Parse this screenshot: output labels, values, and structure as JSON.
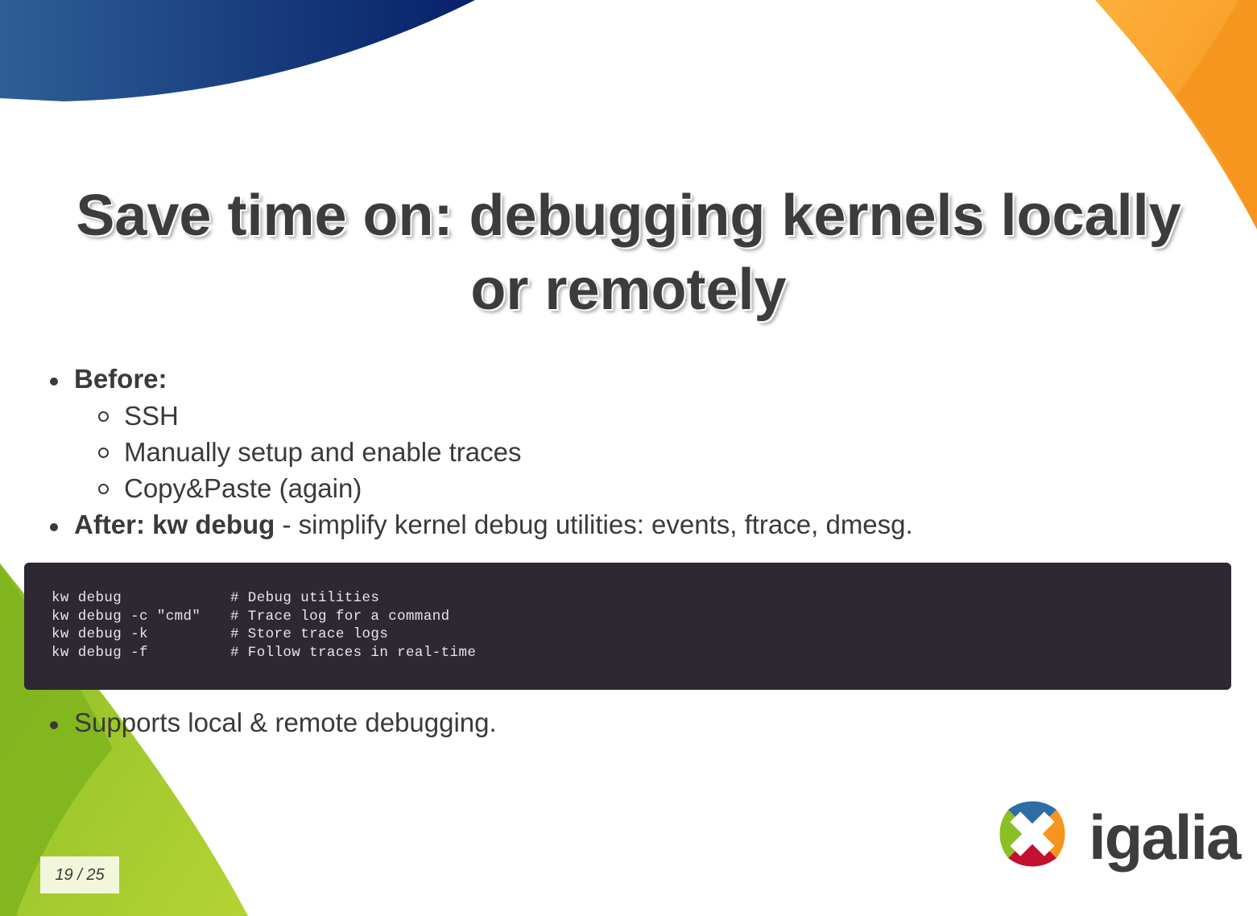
{
  "slide": {
    "title_line1": "Save time on: debugging kernels locally",
    "title_line2": "or remotely",
    "before_label": "Before:",
    "before_items": [
      "SSH",
      "Manually setup and enable traces",
      "Copy&Paste (again)"
    ],
    "after_label": "After: kw debug",
    "after_text": " - simplify kernel debug utilities: events, ftrace, dmesg.",
    "code_lines": [
      {
        "cmd": "kw debug",
        "comment": "# Debug utilities"
      },
      {
        "cmd": "kw debug -c \"cmd\"",
        "comment": "# Trace log for a command"
      },
      {
        "cmd": "kw debug -k",
        "comment": "# Store trace logs"
      },
      {
        "cmd": "kw debug -f",
        "comment": "# Follow traces in real-time"
      }
    ],
    "final_item": "Supports local & remote debugging.",
    "page_indicator": "19 / 25",
    "logo_text": "igalia"
  },
  "colors": {
    "blue_banner": "#0b2a6f",
    "orange_banner": "#f7941d",
    "green_banner": "#8cbf26",
    "code_bg": "#2e2833"
  }
}
